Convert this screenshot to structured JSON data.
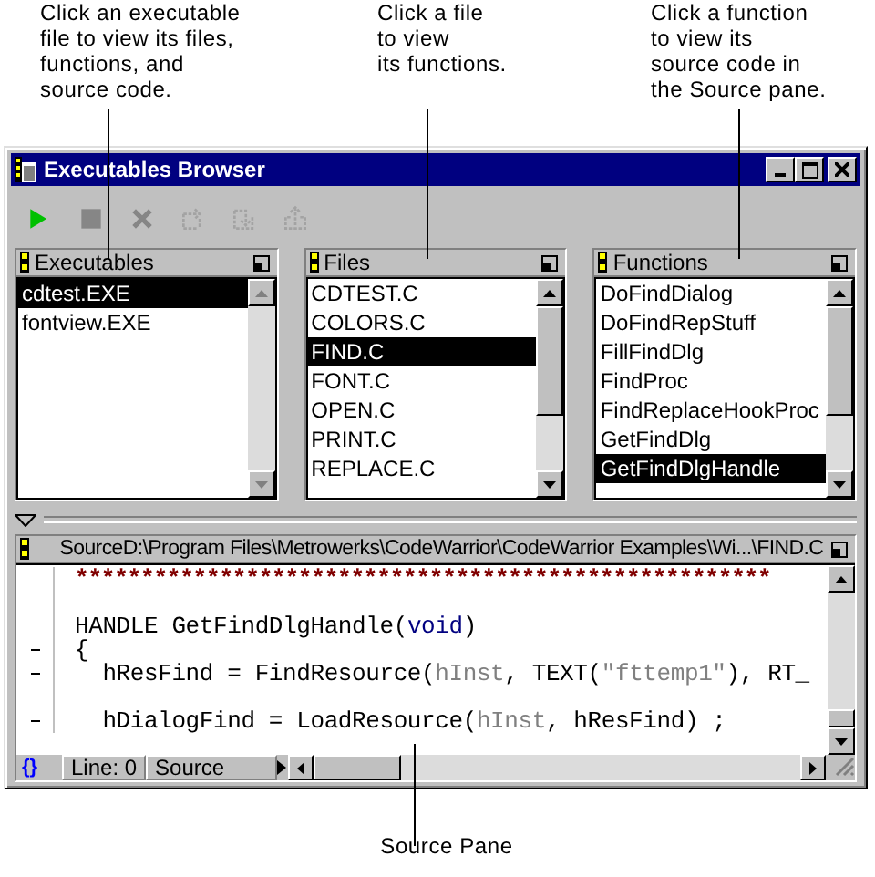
{
  "callouts": [
    {
      "text": "Click an executable\nfile to view its files,\nfunctions, and\nsource code."
    },
    {
      "text": "Click a file\nto view\nits functions."
    },
    {
      "text": "Click a function\nto view its\nsource code in\nthe Source pane."
    }
  ],
  "window": {
    "title": "Executables Browser"
  },
  "toolbar": [
    {
      "kind": "run",
      "disabled": false
    },
    {
      "kind": "stop",
      "disabled": true
    },
    {
      "kind": "kill",
      "disabled": true
    },
    {
      "kind": "step-over",
      "disabled": true
    },
    {
      "kind": "step-into",
      "disabled": true
    },
    {
      "kind": "step-out",
      "disabled": true
    }
  ],
  "panes": [
    {
      "title": "Executables",
      "scrollable": false,
      "items": [
        {
          "label": "cdtest.EXE",
          "selected": true
        },
        {
          "label": "fontview.EXE",
          "selected": false
        }
      ]
    },
    {
      "title": "Files",
      "scrollable": true,
      "items": [
        {
          "label": "CDTEST.C",
          "selected": false
        },
        {
          "label": "COLORS.C",
          "selected": false
        },
        {
          "label": "FIND.C",
          "selected": true
        },
        {
          "label": "FONT.C",
          "selected": false
        },
        {
          "label": "OPEN.C",
          "selected": false
        },
        {
          "label": "PRINT.C",
          "selected": false
        },
        {
          "label": "REPLACE.C",
          "selected": false
        }
      ]
    },
    {
      "title": "Functions",
      "scrollable": true,
      "items": [
        {
          "label": "DoFindDialog",
          "selected": false
        },
        {
          "label": "DoFindRepStuff",
          "selected": false
        },
        {
          "label": "FillFindDlg",
          "selected": false
        },
        {
          "label": "FindProc",
          "selected": false
        },
        {
          "label": "FindReplaceHookProc",
          "selected": false
        },
        {
          "label": "GetFindDlg",
          "selected": false
        },
        {
          "label": "GetFindDlgHandle",
          "selected": true
        }
      ]
    }
  ],
  "source": {
    "title": "SourceD:\\Program Files\\Metrowerks\\CodeWarrior\\CodeWarrior Examples\\Wi...\\FIND.C",
    "lines": [
      {
        "marked": false,
        "tokens": [
          {
            "kind": "comment",
            "text": "*****************************************************"
          }
        ]
      },
      {
        "marked": false
      },
      {
        "marked": false,
        "tokens": [
          {
            "kind": "plain",
            "text": "HANDLE GetFindDlgHandle("
          },
          {
            "kind": "keyword",
            "text": "void"
          },
          {
            "kind": "plain",
            "text": ")"
          }
        ]
      },
      {
        "marked": true,
        "tokens": [
          {
            "kind": "plain",
            "text": "{"
          }
        ]
      },
      {
        "marked": true,
        "tokens": [
          {
            "kind": "plain",
            "text": "  hResFind = FindResource("
          },
          {
            "kind": "ident",
            "text": "hInst"
          },
          {
            "kind": "plain",
            "text": ", TEXT("
          },
          {
            "kind": "ident",
            "text": "\"fttemp1\""
          },
          {
            "kind": "plain",
            "text": "), RT_"
          }
        ]
      },
      {
        "marked": false
      },
      {
        "marked": true,
        "tokens": [
          {
            "kind": "plain",
            "text": "  hDialogFind = LoadResource("
          },
          {
            "kind": "ident",
            "text": "hInst"
          },
          {
            "kind": "plain",
            "text": ", hResFind) ;"
          }
        ]
      }
    ],
    "status": {
      "braces": "{}",
      "line": "Line: 0",
      "mode": "Source"
    }
  },
  "bottom_callout": {
    "text": "Source Pane"
  }
}
